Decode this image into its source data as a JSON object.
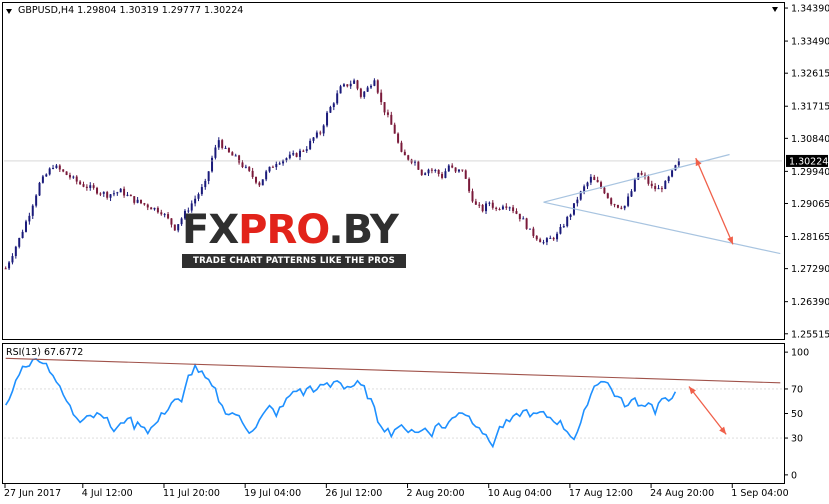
{
  "chart_data": [
    {
      "type": "candlestick",
      "symbol": "GBPUSD,H4",
      "ohlc_label": {
        "open": "1.29804",
        "high": "1.30319",
        "low": "1.29777",
        "close": "1.30224"
      },
      "y_ticks": [
        "1.34390",
        "1.33490",
        "1.32615",
        "1.31715",
        "1.30840",
        "1.29940",
        "1.29065",
        "1.28165",
        "1.27290",
        "1.26390",
        "1.25515"
      ],
      "ylim": [
        1.254,
        1.345
      ],
      "current_price": "1.30224",
      "x_ticks": [
        "27 Jun 2017",
        "4 Jul 12:00",
        "11 Jul 20:00",
        "19 Jul 04:00",
        "26 Jul 12:00",
        "2 Aug 20:00",
        "10 Aug 04:00",
        "17 Aug 12:00",
        "24 Aug 20:00",
        "1 Sep 04:00"
      ],
      "close_waypoints": [
        [
          0,
          1.273
        ],
        [
          4,
          1.281
        ],
        [
          7,
          1.288
        ],
        [
          10,
          1.296
        ],
        [
          14,
          1.301
        ],
        [
          18,
          1.2985
        ],
        [
          22,
          1.296
        ],
        [
          26,
          1.2945
        ],
        [
          30,
          1.293
        ],
        [
          34,
          1.294
        ],
        [
          38,
          1.2915
        ],
        [
          42,
          1.29
        ],
        [
          46,
          1.2885
        ],
        [
          50,
          1.284
        ],
        [
          53,
          1.288
        ],
        [
          56,
          1.292
        ],
        [
          59,
          1.296
        ],
        [
          61,
          1.303
        ],
        [
          63,
          1.308
        ],
        [
          65,
          1.305
        ],
        [
          68,
          1.303
        ],
        [
          71,
          1.3
        ],
        [
          73,
          1.298
        ],
        [
          75,
          1.296
        ],
        [
          77,
          1.299
        ],
        [
          80,
          1.302
        ],
        [
          83,
          1.303
        ],
        [
          86,
          1.304
        ],
        [
          89,
          1.306
        ],
        [
          91,
          1.3085
        ],
        [
          93,
          1.31
        ],
        [
          95,
          1.315
        ],
        [
          97,
          1.3185
        ],
        [
          99,
          1.322
        ],
        [
          101,
          1.323
        ],
        [
          103,
          1.324
        ],
        [
          105,
          1.32
        ],
        [
          107,
          1.322
        ],
        [
          109,
          1.325
        ],
        [
          111,
          1.318
        ],
        [
          113,
          1.314
        ],
        [
          115,
          1.31
        ],
        [
          117,
          1.304
        ],
        [
          119,
          1.303
        ],
        [
          121,
          1.302
        ],
        [
          123,
          1.299
        ],
        [
          125,
          1.3
        ],
        [
          127,
          1.2995
        ],
        [
          129,
          1.298
        ],
        [
          131,
          1.301
        ],
        [
          133,
          1.299
        ],
        [
          135,
          1.3
        ],
        [
          137,
          1.294
        ],
        [
          139,
          1.29
        ],
        [
          141,
          1.289
        ],
        [
          143,
          1.291
        ],
        [
          145,
          1.289
        ],
        [
          147,
          1.2905
        ],
        [
          149,
          1.29
        ],
        [
          151,
          1.288
        ],
        [
          153,
          1.286
        ],
        [
          155,
          1.283
        ],
        [
          157,
          1.2815
        ],
        [
          159,
          1.28
        ],
        [
          161,
          1.281
        ],
        [
          163,
          1.282
        ],
        [
          165,
          1.285
        ],
        [
          167,
          1.288
        ],
        [
          169,
          1.292
        ],
        [
          171,
          1.295
        ],
        [
          173,
          1.2975
        ],
        [
          175,
          1.296
        ],
        [
          177,
          1.294
        ],
        [
          179,
          1.291
        ],
        [
          181,
          1.29
        ],
        [
          183,
          1.29
        ],
        [
          185,
          1.294
        ],
        [
          187,
          1.299
        ],
        [
          189,
          1.2975
        ],
        [
          191,
          1.295
        ],
        [
          193,
          1.2945
        ],
        [
          195,
          1.296
        ],
        [
          197,
          1.299
        ],
        [
          199,
          1.3022
        ]
      ],
      "trendlines": {
        "upper": [
          [
            159,
            1.291
          ],
          [
            214,
            1.304
          ]
        ],
        "lower": [
          [
            159,
            1.291
          ],
          [
            229,
            1.277
          ]
        ]
      },
      "arrow": {
        "from": [
          204,
          1.303
        ],
        "to": [
          215,
          1.2795
        ]
      }
    },
    {
      "type": "line",
      "title": "RSI(13) 67.6772",
      "y_ticks": [
        "100",
        "70",
        "50",
        "30",
        "0"
      ],
      "ylim": [
        -5,
        105
      ],
      "values_waypoints": [
        [
          0,
          55
        ],
        [
          2,
          68
        ],
        [
          4,
          84
        ],
        [
          6,
          90
        ],
        [
          8,
          92
        ],
        [
          10,
          95
        ],
        [
          12,
          90
        ],
        [
          14,
          82
        ],
        [
          16,
          70
        ],
        [
          18,
          60
        ],
        [
          20,
          50
        ],
        [
          22,
          45
        ],
        [
          24,
          50
        ],
        [
          26,
          48
        ],
        [
          28,
          52
        ],
        [
          30,
          44
        ],
        [
          32,
          36
        ],
        [
          34,
          40
        ],
        [
          36,
          48
        ],
        [
          38,
          40
        ],
        [
          40,
          42
        ],
        [
          42,
          36
        ],
        [
          44,
          40
        ],
        [
          46,
          48
        ],
        [
          48,
          55
        ],
        [
          50,
          62
        ],
        [
          52,
          58
        ],
        [
          54,
          80
        ],
        [
          56,
          88
        ],
        [
          58,
          82
        ],
        [
          60,
          75
        ],
        [
          62,
          68
        ],
        [
          64,
          55
        ],
        [
          66,
          50
        ],
        [
          68,
          50
        ],
        [
          70,
          42
        ],
        [
          72,
          36
        ],
        [
          74,
          40
        ],
        [
          76,
          48
        ],
        [
          78,
          55
        ],
        [
          80,
          50
        ],
        [
          82,
          56
        ],
        [
          84,
          65
        ],
        [
          86,
          70
        ],
        [
          88,
          66
        ],
        [
          90,
          72
        ],
        [
          92,
          68
        ],
        [
          94,
          74
        ],
        [
          96,
          72
        ],
        [
          98,
          78
        ],
        [
          100,
          72
        ],
        [
          102,
          72
        ],
        [
          104,
          74
        ],
        [
          106,
          70
        ],
        [
          108,
          60
        ],
        [
          110,
          45
        ],
        [
          112,
          38
        ],
        [
          114,
          34
        ],
        [
          116,
          40
        ],
        [
          118,
          36
        ],
        [
          120,
          38
        ],
        [
          122,
          34
        ],
        [
          124,
          38
        ],
        [
          126,
          34
        ],
        [
          128,
          42
        ],
        [
          130,
          38
        ],
        [
          132,
          46
        ],
        [
          134,
          52
        ],
        [
          136,
          50
        ],
        [
          138,
          44
        ],
        [
          140,
          40
        ],
        [
          142,
          30
        ],
        [
          144,
          25
        ],
        [
          146,
          38
        ],
        [
          148,
          42
        ],
        [
          150,
          45
        ],
        [
          152,
          50
        ],
        [
          154,
          52
        ],
        [
          156,
          48
        ],
        [
          158,
          50
        ],
        [
          160,
          48
        ],
        [
          162,
          45
        ],
        [
          164,
          42
        ],
        [
          166,
          36
        ],
        [
          168,
          30
        ],
        [
          170,
          40
        ],
        [
          172,
          60
        ],
        [
          174,
          72
        ],
        [
          176,
          78
        ],
        [
          178,
          74
        ],
        [
          180,
          66
        ],
        [
          182,
          60
        ],
        [
          184,
          56
        ],
        [
          186,
          62
        ],
        [
          188,
          56
        ],
        [
          190,
          60
        ],
        [
          192,
          52
        ],
        [
          194,
          62
        ],
        [
          196,
          58
        ],
        [
          198,
          67.7
        ]
      ],
      "trendline": [
        [
          0,
          95
        ],
        [
          229,
          75
        ]
      ],
      "arrow": {
        "from": [
          202,
          72
        ],
        "to": [
          213,
          33
        ]
      }
    }
  ],
  "watermark": {
    "brand_fx": "FX",
    "brand_pro": "PRO",
    "brand_by": ".BY",
    "tagline": "TRADE CHART PATTERNS LIKE THE PROS"
  },
  "colors": {
    "bull": "#1a1a7a",
    "bear": "#7a1a3a",
    "rsi": "#1e90ff",
    "trend": "#a8c4e0",
    "rsi_trend": "#a0524a",
    "arrow": "#f0604a"
  }
}
